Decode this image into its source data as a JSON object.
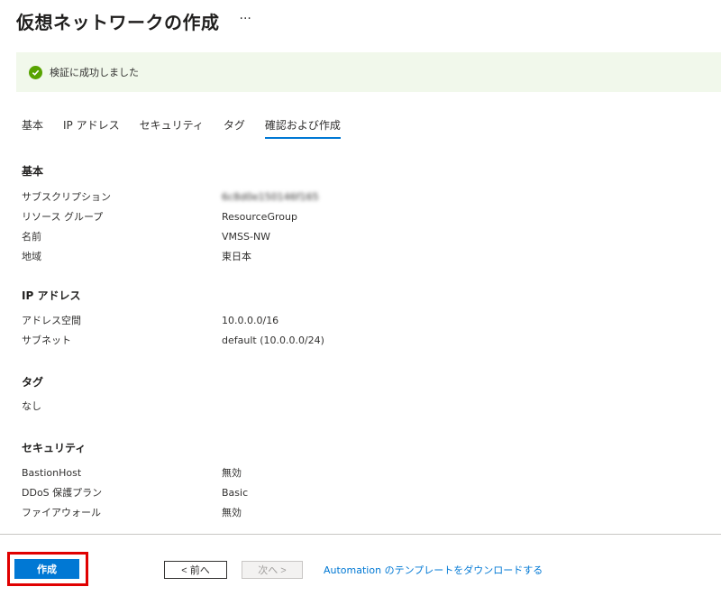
{
  "header": {
    "title": "仮想ネットワークの作成",
    "more": "···"
  },
  "banner": {
    "icon": "check-circle-icon",
    "text": "検証に成功しました",
    "color": "#57a300"
  },
  "tabs": [
    {
      "label": "基本"
    },
    {
      "label": "IP アドレス"
    },
    {
      "label": "セキュリティ"
    },
    {
      "label": "タグ"
    },
    {
      "label": "確認および作成",
      "active": true
    }
  ],
  "sections": {
    "basics": {
      "heading": "基本",
      "rows": [
        {
          "label": "サブスクリプション",
          "value": "6c8d0e150146f165"
        },
        {
          "label": "リソース グループ",
          "value": "ResourceGroup"
        },
        {
          "label": "名前",
          "value": "VMSS-NW"
        },
        {
          "label": "地域",
          "value": "東日本"
        }
      ]
    },
    "ip": {
      "heading": "IP アドレス",
      "rows": [
        {
          "label": "アドレス空間",
          "value": "10.0.0.0/16"
        },
        {
          "label": "サブネット",
          "value": "default (10.0.0.0/24)"
        }
      ]
    },
    "tags": {
      "heading": "タグ",
      "text": "なし"
    },
    "security": {
      "heading": "セキュリティ",
      "rows": [
        {
          "label": "BastionHost",
          "value": "無効"
        },
        {
          "label": "DDoS 保護プラン",
          "value": "Basic"
        },
        {
          "label": "ファイアウォール",
          "value": "無効"
        }
      ]
    }
  },
  "footer": {
    "create": "作成",
    "prev": "< 前へ",
    "next": "次へ >",
    "automation": "Automation のテンプレートをダウンロードする"
  },
  "colors": {
    "accent": "#0078d4",
    "highlight": "#e00000"
  }
}
